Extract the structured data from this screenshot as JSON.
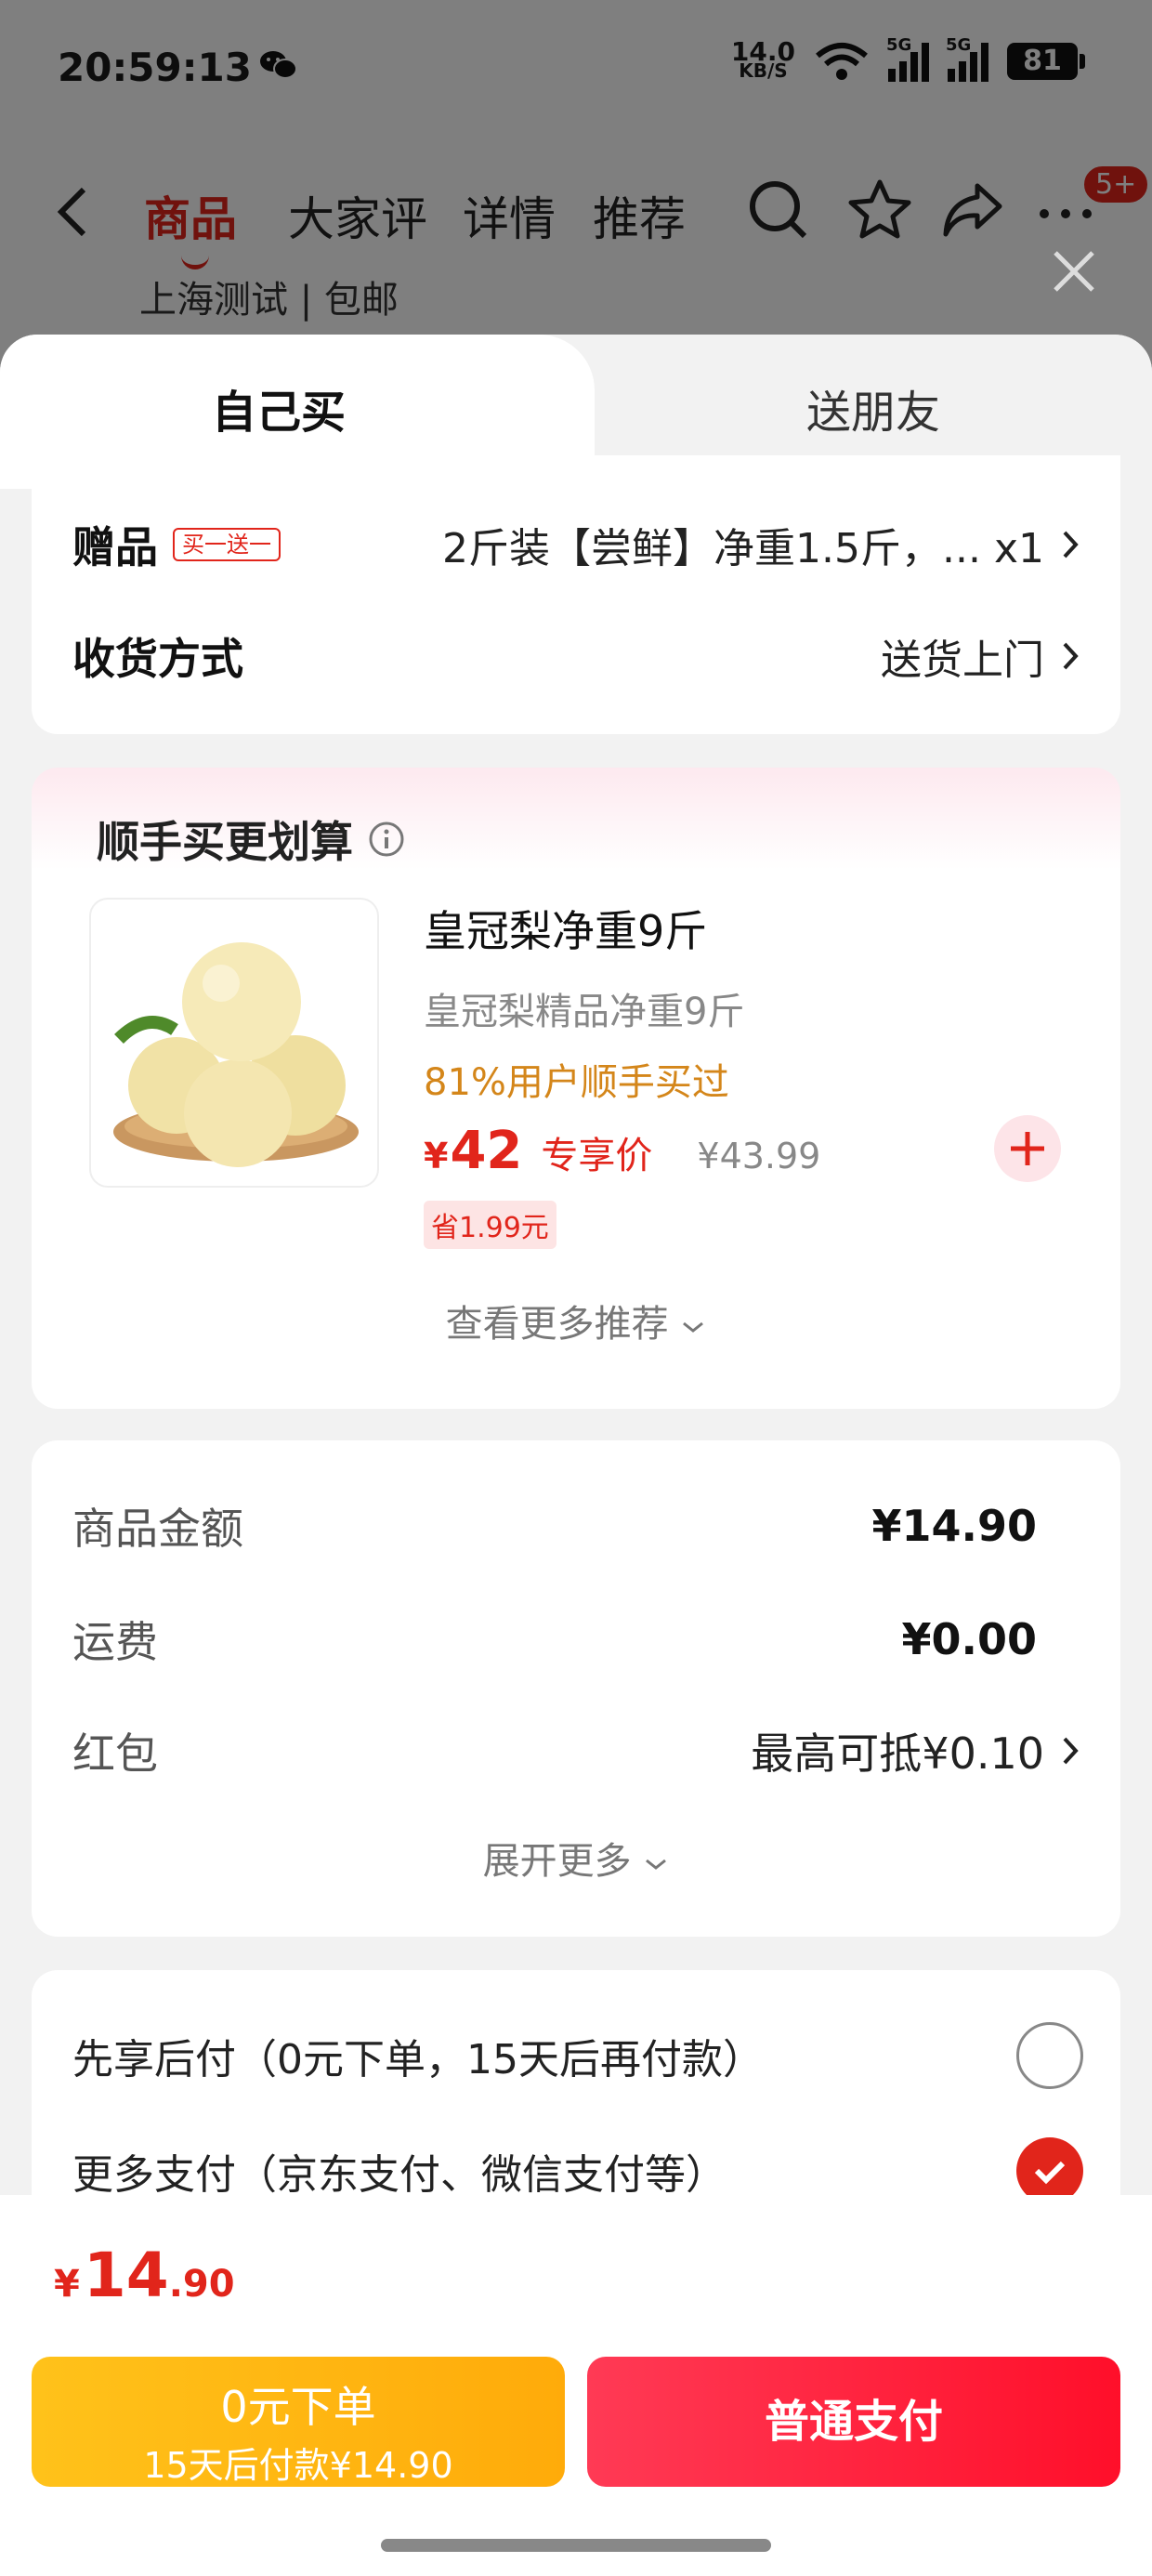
{
  "status_bar": {
    "time": "20:59:13",
    "net_speed_value": "14.0",
    "net_speed_unit": "KB/S",
    "signal_1_label": "5G",
    "signal_2_label": "5G",
    "battery": "81"
  },
  "nav": {
    "tabs": [
      "商品",
      "大家评",
      "详情",
      "推荐"
    ],
    "active_tab": 0,
    "badge": "5+",
    "peek_text": "上海测试 | 包邮"
  },
  "sheet_tabs": {
    "self": "自己买",
    "friend": "送朋友"
  },
  "gift_card": {
    "gift_label": "赠品",
    "gift_tag": "买一送一",
    "gift_value": "2斤装【尝鲜】净重1.5斤，... x1",
    "delivery_label": "收货方式",
    "delivery_value": "送货上门"
  },
  "recommend": {
    "title": "顺手买更划算",
    "product_title": "皇冠梨净重9斤",
    "product_subtitle": "皇冠梨精品净重9斤",
    "buy_rate": "81%用户顺手买过",
    "price_currency": "¥",
    "price": "42",
    "price_tag": "专享价",
    "original_price": "¥43.99",
    "save_tag": "省1.99元",
    "more_link": "查看更多推荐"
  },
  "amounts": {
    "goods_label": "商品金额",
    "goods_value": "¥14.90",
    "shipping_label": "运费",
    "shipping_value": "¥0.00",
    "redpack_label": "红包",
    "redpack_value": "最高可抵¥0.10",
    "expand_link": "展开更多"
  },
  "payment": {
    "option_later": "先享后付（0元下单，15天后再付款）",
    "option_later_selected": false,
    "option_more": "更多支付（京东支付、微信支付等）",
    "option_more_selected": true
  },
  "bottom": {
    "total_currency": "¥",
    "total_int": "14",
    "total_dec": ".90",
    "later_btn_line1": "0元下单",
    "later_btn_line2": "15天后付款¥14.90",
    "pay_btn": "普通支付"
  },
  "colors": {
    "accent": "#e1251b",
    "orange_button": "#ffb612",
    "red_button": "#ff1f3a",
    "buy_rate_text": "#d4861a"
  },
  "icons": [
    "wechat-icon",
    "wifi-icon",
    "back-icon",
    "search-icon",
    "star-icon",
    "share-icon",
    "more-icon",
    "close-icon",
    "chevron-right-icon",
    "info-icon",
    "plus-icon",
    "chevron-down-icon",
    "check-icon"
  ]
}
